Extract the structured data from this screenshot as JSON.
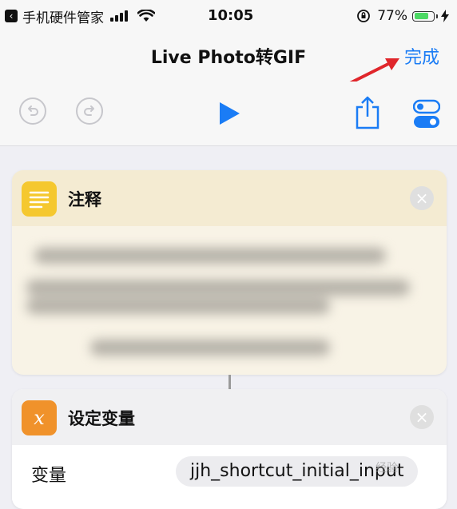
{
  "status_bar": {
    "back_app": "手机硬件管家",
    "time": "10:05",
    "battery_percent": "77%",
    "battery_level": 0.77
  },
  "nav": {
    "title": "Live Photo转GIF",
    "done_label": "完成"
  },
  "toolbar": {
    "undo_icon": "undo-icon",
    "redo_icon": "redo-icon",
    "play_icon": "play-icon",
    "share_icon": "share-icon",
    "settings_icon": "toggle-settings-icon",
    "accent_color": "#1a7cf5"
  },
  "actions": [
    {
      "title": "注释",
      "icon": "text-lines-icon",
      "icon_color": "#f5c82f",
      "content_blurred": true
    },
    {
      "title": "设定变量",
      "icon": "variable-x-icon",
      "icon_color": "#f0922b",
      "field_label": "变量",
      "field_value": "jjh_shortcut_initial_input"
    }
  ],
  "watermark": "经验"
}
